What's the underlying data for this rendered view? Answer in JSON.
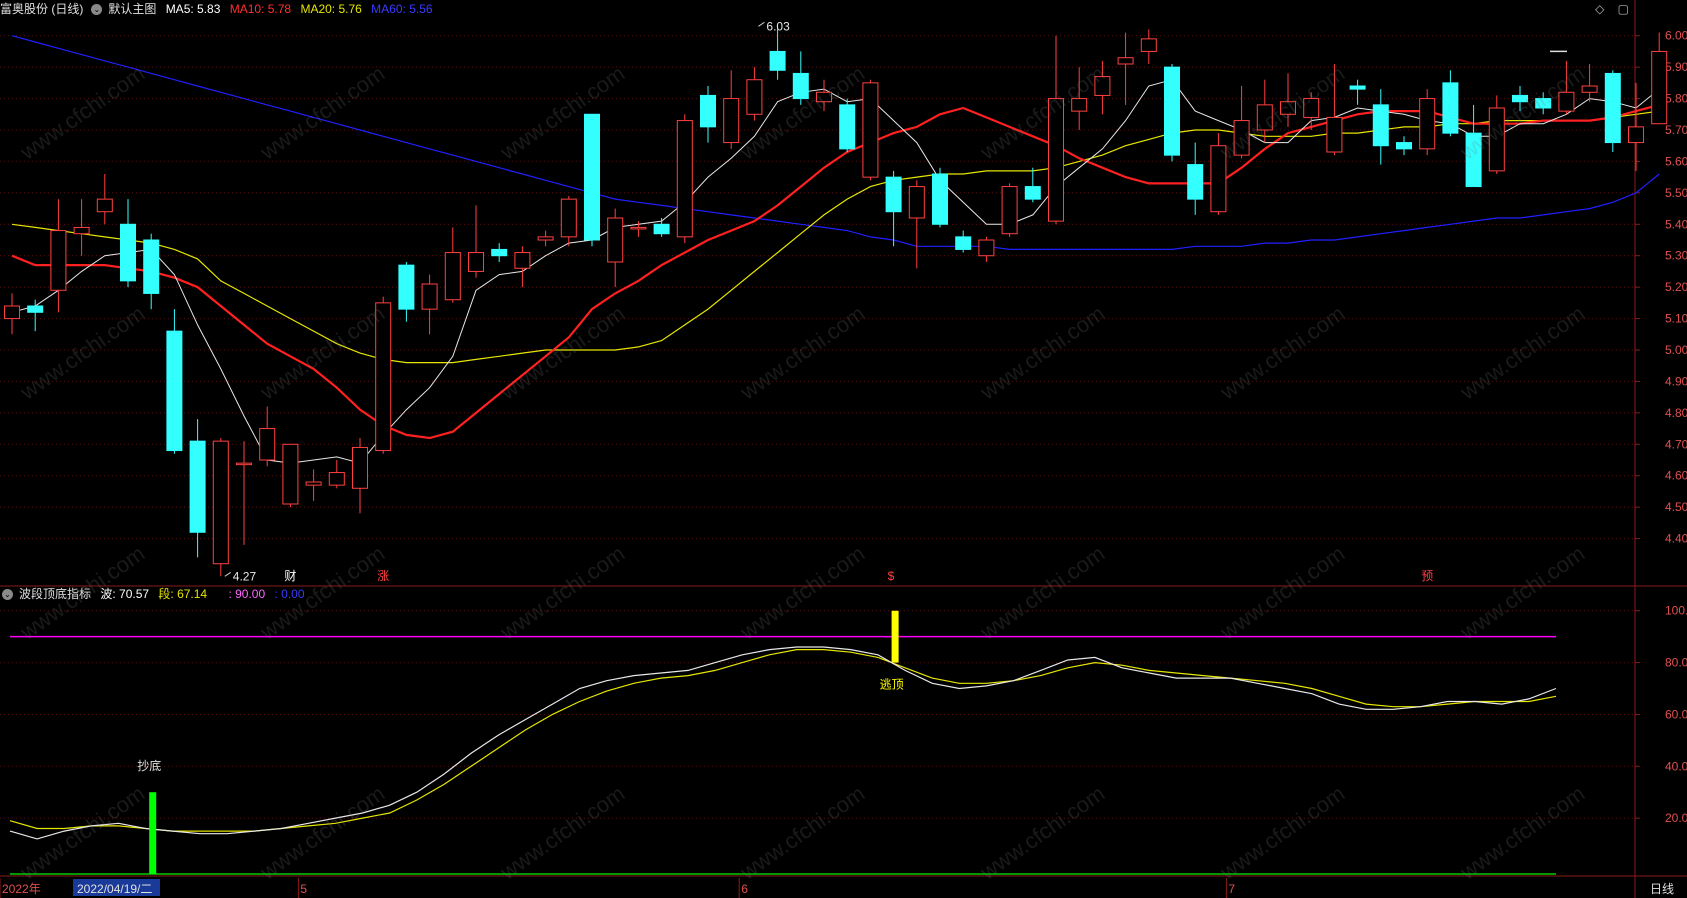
{
  "header_main": {
    "stock_name": "富奥股份 (日线)",
    "chart_name": "默认主图",
    "ma5": "MA5: 5.83",
    "ma10": "MA10: 5.78",
    "ma20": "MA20: 5.76",
    "ma60": "MA60: 5.56"
  },
  "header_sub": {
    "indicator_name": "波段顶底指标",
    "wave": "波: 70.57",
    "segment": "段: 67.14",
    "level": ": 90.00",
    "base": ": 0.00"
  },
  "top_icons": {
    "diamond": "◇",
    "square": "▢"
  },
  "watermark": "www.cfchi.com",
  "colors": {
    "up": "#ff4040",
    "down": "#33ffff",
    "ma5": "#e8e8e8",
    "ma10": "#ff2020",
    "ma20": "#e6e600",
    "ma60": "#2020ff",
    "axis": "#8b1a1a",
    "level": "#ff00ff",
    "signal_buy": "#00ff00",
    "signal_sell": "#ffff00"
  },
  "chart_data": [
    {
      "type": "candlestick",
      "ylim": [
        4.3,
        6.05
      ],
      "yticks": [
        "6.00",
        "5.90",
        "5.80",
        "5.70",
        "5.60",
        "5.50",
        "5.40",
        "5.30",
        "5.20",
        "5.10",
        "5.00",
        "4.90",
        "4.80",
        "4.70",
        "4.60",
        "4.50",
        "4.40"
      ],
      "candles": [
        {
          "o": 5.1,
          "c": 5.14,
          "h": 5.18,
          "l": 5.05
        },
        {
          "o": 5.14,
          "c": 5.12,
          "h": 5.16,
          "l": 5.06
        },
        {
          "o": 5.19,
          "c": 5.38,
          "h": 5.48,
          "l": 5.12
        },
        {
          "o": 5.37,
          "c": 5.39,
          "h": 5.48,
          "l": 5.3
        },
        {
          "o": 5.44,
          "c": 5.48,
          "h": 5.56,
          "l": 5.4
        },
        {
          "o": 5.4,
          "c": 5.22,
          "h": 5.48,
          "l": 5.2
        },
        {
          "o": 5.35,
          "c": 5.18,
          "h": 5.37,
          "l": 5.13
        },
        {
          "o": 5.06,
          "c": 4.68,
          "h": 5.13,
          "l": 4.67
        },
        {
          "o": 4.71,
          "c": 4.42,
          "h": 4.78,
          "l": 4.34
        },
        {
          "o": 4.32,
          "c": 4.71,
          "h": 4.72,
          "l": 4.28
        },
        {
          "o": 4.64,
          "c": 4.64,
          "h": 4.71,
          "l": 4.38
        },
        {
          "o": 4.65,
          "c": 4.75,
          "h": 4.82,
          "l": 4.63
        },
        {
          "o": 4.51,
          "c": 4.7,
          "h": 4.7,
          "l": 4.5
        },
        {
          "o": 4.57,
          "c": 4.58,
          "h": 4.62,
          "l": 4.52
        },
        {
          "o": 4.57,
          "c": 4.61,
          "h": 4.65,
          "l": 4.56
        },
        {
          "o": 4.56,
          "c": 4.69,
          "h": 4.72,
          "l": 4.48
        },
        {
          "o": 4.68,
          "c": 5.15,
          "h": 5.17,
          "l": 4.67
        },
        {
          "o": 5.27,
          "c": 5.13,
          "h": 5.28,
          "l": 5.09
        },
        {
          "o": 5.13,
          "c": 5.21,
          "h": 5.24,
          "l": 5.05
        },
        {
          "o": 5.16,
          "c": 5.31,
          "h": 5.39,
          "l": 5.15
        },
        {
          "o": 5.25,
          "c": 5.31,
          "h": 5.46,
          "l": 5.23
        },
        {
          "o": 5.32,
          "c": 5.3,
          "h": 5.34,
          "l": 5.28
        },
        {
          "o": 5.26,
          "c": 5.31,
          "h": 5.33,
          "l": 5.2
        },
        {
          "o": 5.35,
          "c": 5.36,
          "h": 5.38,
          "l": 5.33
        },
        {
          "o": 5.36,
          "c": 5.48,
          "h": 5.49,
          "l": 5.33
        },
        {
          "o": 5.75,
          "c": 5.35,
          "h": 5.75,
          "l": 5.33
        },
        {
          "o": 5.28,
          "c": 5.42,
          "h": 5.45,
          "l": 5.2
        },
        {
          "o": 5.39,
          "c": 5.39,
          "h": 5.41,
          "l": 5.36
        },
        {
          "o": 5.4,
          "c": 5.37,
          "h": 5.42,
          "l": 5.36
        },
        {
          "o": 5.36,
          "c": 5.73,
          "h": 5.75,
          "l": 5.34
        },
        {
          "o": 5.81,
          "c": 5.71,
          "h": 5.84,
          "l": 5.66
        },
        {
          "o": 5.66,
          "c": 5.8,
          "h": 5.89,
          "l": 5.64
        },
        {
          "o": 5.75,
          "c": 5.86,
          "h": 5.9,
          "l": 5.73
        },
        {
          "o": 5.95,
          "c": 5.89,
          "h": 6.03,
          "l": 5.86
        },
        {
          "o": 5.88,
          "c": 5.8,
          "h": 5.95,
          "l": 5.78
        },
        {
          "o": 5.79,
          "c": 5.82,
          "h": 5.86,
          "l": 5.76
        },
        {
          "o": 5.78,
          "c": 5.64,
          "h": 5.8,
          "l": 5.63
        },
        {
          "o": 5.55,
          "c": 5.85,
          "h": 5.86,
          "l": 5.54
        },
        {
          "o": 5.55,
          "c": 5.44,
          "h": 5.57,
          "l": 5.33
        },
        {
          "o": 5.42,
          "c": 5.52,
          "h": 5.54,
          "l": 5.26
        },
        {
          "o": 5.56,
          "c": 5.4,
          "h": 5.58,
          "l": 5.39
        },
        {
          "o": 5.36,
          "c": 5.32,
          "h": 5.38,
          "l": 5.31
        },
        {
          "o": 5.3,
          "c": 5.35,
          "h": 5.36,
          "l": 5.28
        },
        {
          "o": 5.37,
          "c": 5.52,
          "h": 5.53,
          "l": 5.36
        },
        {
          "o": 5.52,
          "c": 5.48,
          "h": 5.58,
          "l": 5.47
        },
        {
          "o": 5.41,
          "c": 5.8,
          "h": 6.0,
          "l": 5.4
        },
        {
          "o": 5.76,
          "c": 5.8,
          "h": 5.9,
          "l": 5.7
        },
        {
          "o": 5.81,
          "c": 5.87,
          "h": 5.92,
          "l": 5.75
        },
        {
          "o": 5.91,
          "c": 5.93,
          "h": 6.01,
          "l": 5.78
        },
        {
          "o": 5.95,
          "c": 5.99,
          "h": 6.02,
          "l": 5.91
        },
        {
          "o": 5.9,
          "c": 5.62,
          "h": 5.91,
          "l": 5.6
        },
        {
          "o": 5.59,
          "c": 5.48,
          "h": 5.66,
          "l": 5.43
        },
        {
          "o": 5.44,
          "c": 5.65,
          "h": 5.69,
          "l": 5.43
        },
        {
          "o": 5.62,
          "c": 5.73,
          "h": 5.84,
          "l": 5.61
        },
        {
          "o": 5.7,
          "c": 5.78,
          "h": 5.86,
          "l": 5.66
        },
        {
          "o": 5.75,
          "c": 5.79,
          "h": 5.88,
          "l": 5.71
        },
        {
          "o": 5.74,
          "c": 5.8,
          "h": 5.82,
          "l": 5.7
        },
        {
          "o": 5.63,
          "c": 5.74,
          "h": 5.91,
          "l": 5.62
        },
        {
          "o": 5.84,
          "c": 5.83,
          "h": 5.86,
          "l": 5.78
        },
        {
          "o": 5.78,
          "c": 5.65,
          "h": 5.83,
          "l": 5.59
        },
        {
          "o": 5.66,
          "c": 5.64,
          "h": 5.68,
          "l": 5.62
        },
        {
          "o": 5.64,
          "c": 5.8,
          "h": 5.83,
          "l": 5.62
        },
        {
          "o": 5.85,
          "c": 5.69,
          "h": 5.89,
          "l": 5.68
        },
        {
          "o": 5.69,
          "c": 5.52,
          "h": 5.78,
          "l": 5.52
        },
        {
          "o": 5.57,
          "c": 5.77,
          "h": 5.81,
          "l": 5.56
        },
        {
          "o": 5.81,
          "c": 5.79,
          "h": 5.84,
          "l": 5.76
        },
        {
          "o": 5.8,
          "c": 5.77,
          "h": 5.82,
          "l": 5.75
        },
        {
          "o": 5.76,
          "c": 5.82,
          "h": 5.92,
          "l": 5.75
        },
        {
          "o": 5.82,
          "c": 5.84,
          "h": 5.91,
          "l": 5.79
        },
        {
          "o": 5.88,
          "c": 5.66,
          "h": 5.89,
          "l": 5.63
        },
        {
          "o": 5.66,
          "c": 5.71,
          "h": 5.85,
          "l": 5.57
        },
        {
          "o": 5.72,
          "c": 5.95,
          "h": 6.01,
          "l": 5.72
        }
      ],
      "ma5": [
        5.12,
        5.14,
        5.19,
        5.25,
        5.3,
        5.31,
        5.32,
        5.24,
        5.08,
        4.94,
        4.79,
        4.65,
        4.64,
        4.65,
        4.66,
        4.64,
        4.73,
        4.81,
        4.88,
        4.98,
        5.19,
        5.24,
        5.25,
        5.3,
        5.34,
        5.35,
        5.39,
        5.4,
        5.41,
        5.47,
        5.55,
        5.61,
        5.68,
        5.79,
        5.82,
        5.83,
        5.79,
        5.8,
        5.73,
        5.66,
        5.54,
        5.47,
        5.4,
        5.4,
        5.43,
        5.52,
        5.58,
        5.64,
        5.73,
        5.84,
        5.86,
        5.76,
        5.73,
        5.7,
        5.66,
        5.66,
        5.73,
        5.74,
        5.77,
        5.76,
        5.75,
        5.73,
        5.72,
        5.68,
        5.68,
        5.72,
        5.72,
        5.75,
        5.8,
        5.79,
        5.77,
        5.83
      ],
      "ma10": [
        5.3,
        5.27,
        5.27,
        5.27,
        5.27,
        5.26,
        5.25,
        5.23,
        5.2,
        5.14,
        5.08,
        5.02,
        4.98,
        4.94,
        4.88,
        4.81,
        4.76,
        4.73,
        4.72,
        4.74,
        4.8,
        4.86,
        4.92,
        4.98,
        5.04,
        5.13,
        5.18,
        5.22,
        5.27,
        5.31,
        5.35,
        5.38,
        5.41,
        5.46,
        5.52,
        5.58,
        5.63,
        5.66,
        5.69,
        5.71,
        5.75,
        5.77,
        5.74,
        5.71,
        5.68,
        5.65,
        5.61,
        5.58,
        5.55,
        5.53,
        5.53,
        5.53,
        5.53,
        5.58,
        5.64,
        5.69,
        5.71,
        5.73,
        5.75,
        5.76,
        5.76,
        5.76,
        5.74,
        5.72,
        5.72,
        5.72,
        5.73,
        5.73,
        5.73,
        5.74,
        5.76,
        5.78
      ],
      "ma20": [
        5.4,
        5.39,
        5.38,
        5.37,
        5.36,
        5.35,
        5.34,
        5.32,
        5.29,
        5.22,
        5.18,
        5.14,
        5.1,
        5.06,
        5.02,
        4.99,
        4.97,
        4.96,
        4.96,
        4.96,
        4.97,
        4.98,
        4.99,
        5.0,
        5.0,
        5.0,
        5.0,
        5.01,
        5.03,
        5.08,
        5.13,
        5.19,
        5.25,
        5.31,
        5.37,
        5.43,
        5.48,
        5.52,
        5.54,
        5.55,
        5.56,
        5.56,
        5.57,
        5.57,
        5.57,
        5.58,
        5.6,
        5.62,
        5.65,
        5.67,
        5.69,
        5.7,
        5.7,
        5.69,
        5.68,
        5.68,
        5.68,
        5.69,
        5.69,
        5.7,
        5.71,
        5.71,
        5.72,
        5.72,
        5.73,
        5.73,
        5.73,
        5.73,
        5.73,
        5.74,
        5.75,
        5.76
      ],
      "ma60": [
        6.0,
        5.98,
        5.96,
        5.94,
        5.92,
        5.9,
        5.88,
        5.86,
        5.84,
        5.82,
        5.8,
        5.78,
        5.76,
        5.74,
        5.72,
        5.7,
        5.68,
        5.66,
        5.64,
        5.62,
        5.6,
        5.58,
        5.56,
        5.54,
        5.52,
        5.5,
        5.48,
        5.47,
        5.46,
        5.45,
        5.44,
        5.43,
        5.42,
        5.41,
        5.4,
        5.39,
        5.38,
        5.36,
        5.35,
        5.33,
        5.33,
        5.33,
        5.33,
        5.32,
        5.32,
        5.32,
        5.32,
        5.32,
        5.32,
        5.32,
        5.32,
        5.33,
        5.33,
        5.33,
        5.34,
        5.34,
        5.35,
        5.35,
        5.36,
        5.37,
        5.38,
        5.39,
        5.4,
        5.41,
        5.42,
        5.42,
        5.43,
        5.44,
        5.45,
        5.47,
        5.5,
        5.56
      ],
      "annotations": [
        {
          "label": "6.03",
          "index": 32,
          "value": 6.03
        },
        {
          "label": "4.27",
          "index": 9,
          "value": 4.28
        }
      ],
      "markers": [
        {
          "label": "财",
          "index": 12,
          "color": "#ffffff"
        },
        {
          "label": "涨",
          "index": 16,
          "color": "#ff4040"
        },
        {
          "label": "$",
          "index": 38,
          "color": "#ff4040"
        },
        {
          "label": "预",
          "index": 61,
          "color": "#ff4040"
        }
      ],
      "price_tag": "5.95"
    },
    {
      "type": "line",
      "ylim": [
        0,
        108
      ],
      "yticks": [
        "100.0",
        "80.00",
        "60.00",
        "40.00",
        "20.00"
      ],
      "series": [
        {
          "name": "波",
          "color": "#e8e8e8",
          "values": [
            15,
            12,
            15,
            17,
            18,
            16,
            15,
            14,
            14,
            15,
            16,
            18,
            20,
            22,
            25,
            30,
            37,
            45,
            52,
            58,
            64,
            70,
            73,
            75,
            76,
            77,
            80,
            83,
            85,
            86,
            86,
            85,
            83,
            77,
            72,
            70,
            71,
            73,
            77,
            81,
            82,
            78,
            76,
            74,
            74,
            74,
            72,
            70,
            68,
            64,
            62,
            62,
            63,
            65,
            65,
            64,
            66,
            70
          ]
        },
        {
          "name": "段",
          "color": "#e6e600",
          "values": [
            19,
            16,
            16,
            17,
            17,
            16,
            15,
            15,
            15,
            15,
            16,
            17,
            18,
            20,
            22,
            27,
            33,
            40,
            47,
            54,
            60,
            65,
            69,
            72,
            74,
            75,
            77,
            80,
            83,
            85,
            85,
            84,
            82,
            78,
            74,
            72,
            72,
            73,
            75,
            78,
            80,
            79,
            77,
            76,
            75,
            74,
            73,
            72,
            70,
            67,
            64,
            63,
            63,
            64,
            65,
            65,
            65,
            67
          ]
        }
      ],
      "level_line": {
        "value": 90,
        "color": "#ff00ff"
      },
      "zero_line": {
        "value": 0,
        "color": "#00cc00"
      },
      "signals": [
        {
          "label": "抄底",
          "index": 6,
          "from": 0,
          "to": 30,
          "color": "#00ff00"
        },
        {
          "label": "逃顶",
          "index": 38,
          "from": 80,
          "to": 100,
          "color": "#ffff00"
        }
      ]
    }
  ],
  "x_axis": {
    "labels": [
      {
        "text": "2022年",
        "index": 0
      },
      {
        "text": "5",
        "index": 12
      },
      {
        "text": "6",
        "index": 31
      },
      {
        "text": "7",
        "index": 52
      }
    ],
    "date_box": "2022/04/19/二",
    "period": "日线"
  }
}
